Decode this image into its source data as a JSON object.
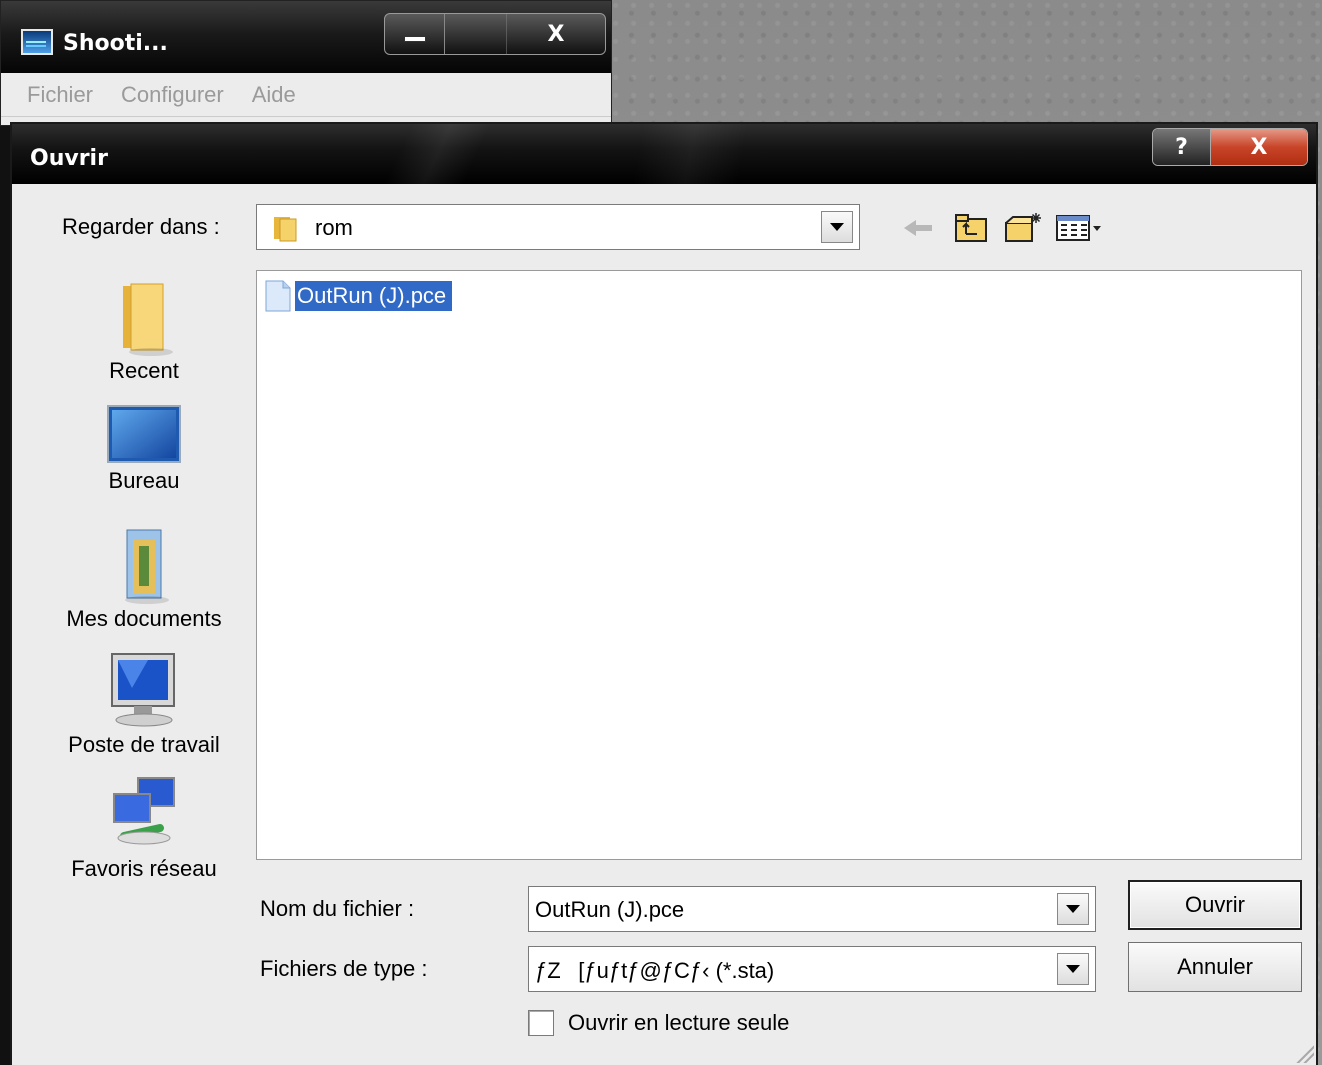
{
  "app": {
    "title": "Shooti...",
    "menu": [
      "Fichier",
      "Configurer",
      "Aide"
    ],
    "minimize_glyph": "",
    "close_glyph": "X"
  },
  "dialog": {
    "title": "Ouvrir",
    "help_glyph": "?",
    "close_glyph": "X",
    "look_in_label": "Regarder dans :",
    "look_in_value": "rom",
    "places": [
      "Recent",
      "Bureau",
      "Mes documents",
      "Poste de travail",
      "Favoris réseau"
    ],
    "files": [
      {
        "name": "OutRun (J).pce",
        "selected": true
      }
    ],
    "filename_label": "Nom du fichier :",
    "filename_value": "OutRun (J).pce",
    "filetype_label": "Fichiers de type :",
    "filetype_value": "ƒZ[ƒuƒtƒ@ƒCƒ‹ (*.sta)",
    "open_button": "Ouvrir",
    "cancel_button": "Annuler",
    "readonly_label": "Ouvrir en lecture seule",
    "readonly_checked": false
  },
  "colors": {
    "selection": "#3169c6",
    "dialog_bg": "#ececec",
    "titlebar": "#0a0a0a"
  },
  "icons": [
    "app-icon",
    "minimize-icon",
    "maximize-icon",
    "close-icon",
    "help-icon",
    "folder-icon",
    "back-arrow-icon",
    "up-folder-icon",
    "new-folder-icon",
    "view-menu-icon",
    "recent-icon",
    "desktop-icon",
    "documents-icon",
    "computer-icon",
    "network-icon",
    "file-icon",
    "chevron-down-icon",
    "resize-grip-icon"
  ]
}
